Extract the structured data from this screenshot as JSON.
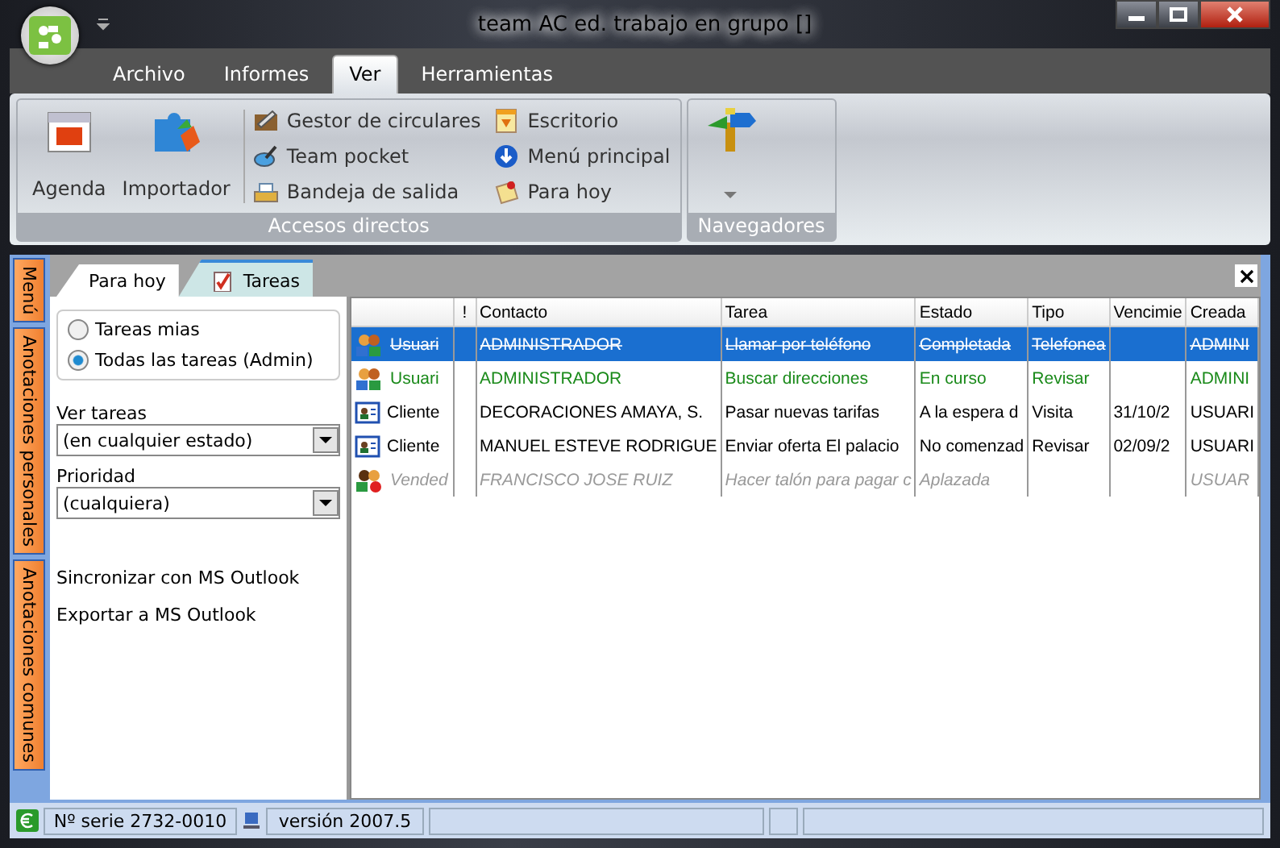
{
  "window": {
    "title": "team AC ed. trabajo en grupo []"
  },
  "ribbon_tabs": [
    {
      "label": "Archivo",
      "selected": false
    },
    {
      "label": "Informes",
      "selected": false
    },
    {
      "label": "Ver",
      "selected": true
    },
    {
      "label": "Herramientas",
      "selected": false
    }
  ],
  "ribbon": {
    "groups": [
      {
        "label": "Accesos directos",
        "large": [
          {
            "label": "Agenda",
            "kind": "calendar"
          },
          {
            "label": "Importador",
            "kind": "puzzle"
          }
        ],
        "small": [
          {
            "label": "Gestor de circulares",
            "kind": "letter"
          },
          {
            "label": "Team pocket",
            "kind": "pocket"
          },
          {
            "label": "Bandeja de salida",
            "kind": "tray"
          },
          {
            "label": "Escritorio",
            "kind": "desk"
          },
          {
            "label": "Menú principal",
            "kind": "down"
          },
          {
            "label": "Para hoy",
            "kind": "note"
          }
        ]
      },
      {
        "label": "Navegadores",
        "large": [
          {
            "kind": "signpost"
          }
        ]
      }
    ]
  },
  "side_tabs": [
    {
      "label": "Menú"
    },
    {
      "label": "Anotaciones personales"
    },
    {
      "label": "Anotaciones comunes"
    }
  ],
  "panel_tabs": [
    {
      "label": "Para hoy",
      "selected": false,
      "icon": false
    },
    {
      "label": "Tareas",
      "selected": true,
      "icon": true
    }
  ],
  "filter": {
    "radios": [
      {
        "label": "Tareas mias",
        "selected": false
      },
      {
        "label": "Todas las tareas (Admin)",
        "selected": true
      }
    ],
    "dropdowns": [
      {
        "label": "Ver tareas",
        "value": "(en cualquier estado)"
      },
      {
        "label": "Prioridad",
        "value": "(cualquiera)"
      }
    ],
    "links": [
      "Sincronizar con MS Outlook",
      "Exportar a MS Outlook"
    ]
  },
  "table": {
    "columns": [
      "",
      "!",
      "Contacto",
      "Tarea",
      "Estado",
      "Tipo",
      "Vencimie",
      "Creada"
    ],
    "rows": [
      {
        "kind": "users",
        "completed": true,
        "in_progress": false,
        "postponed": false,
        "selected": true,
        "cells": [
          "Usuari",
          "",
          "ADMINISTRADOR",
          "Llamar por teléfono",
          "Completada",
          "Telefonea",
          "",
          "ADMINI"
        ]
      },
      {
        "kind": "users",
        "completed": false,
        "in_progress": true,
        "postponed": false,
        "selected": false,
        "cells": [
          "Usuari",
          "",
          "ADMINISTRADOR",
          "Buscar direcciones",
          "En curso",
          "Revisar",
          "",
          "ADMINI"
        ]
      },
      {
        "kind": "client",
        "completed": false,
        "in_progress": false,
        "postponed": false,
        "selected": false,
        "cells": [
          "Cliente",
          "",
          "DECORACIONES  AMAYA, S.",
          "Pasar nuevas tarifas",
          "A la espera d",
          "Visita",
          "31/10/2",
          "USUARI"
        ]
      },
      {
        "kind": "client",
        "completed": false,
        "in_progress": false,
        "postponed": false,
        "selected": false,
        "cells": [
          "Cliente",
          "",
          "MANUEL ESTEVE RODRIGUE",
          "Enviar oferta El palacio",
          "No comenzad",
          "Revisar",
          "02/09/2",
          "USUARI"
        ]
      },
      {
        "kind": "seller",
        "completed": false,
        "in_progress": false,
        "postponed": true,
        "selected": false,
        "cells": [
          "Vended",
          "",
          "FRANCISCO JOSE  RUIZ",
          "Hacer talón para pagar c",
          "Aplazada",
          "",
          "",
          "USUAR"
        ]
      }
    ]
  },
  "status_bar": {
    "serial": "Nº serie 2732-0010",
    "version": "versión 2007.5"
  }
}
